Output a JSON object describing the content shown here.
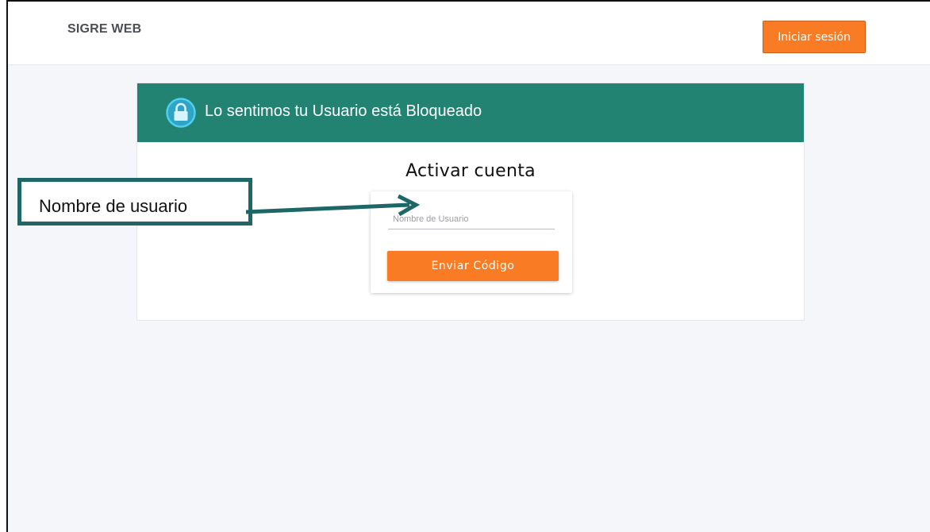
{
  "header": {
    "brand": "SIGRE WEB",
    "login_label": "Iniciar sesión"
  },
  "card": {
    "header_text": "Lo sentimos tu Usuario está Bloqueado",
    "lock_icon": "lock-icon",
    "title": "Activar cuenta",
    "username_placeholder": "Nombre de Usuario",
    "send_label": "Enviar Código"
  },
  "annotation": {
    "callout_label": "Nombre de usuario"
  },
  "colors": {
    "accent_orange": "#f97c25",
    "header_teal": "#238373",
    "callout_border": "#1f6766",
    "page_background": "#f5f6fa"
  }
}
